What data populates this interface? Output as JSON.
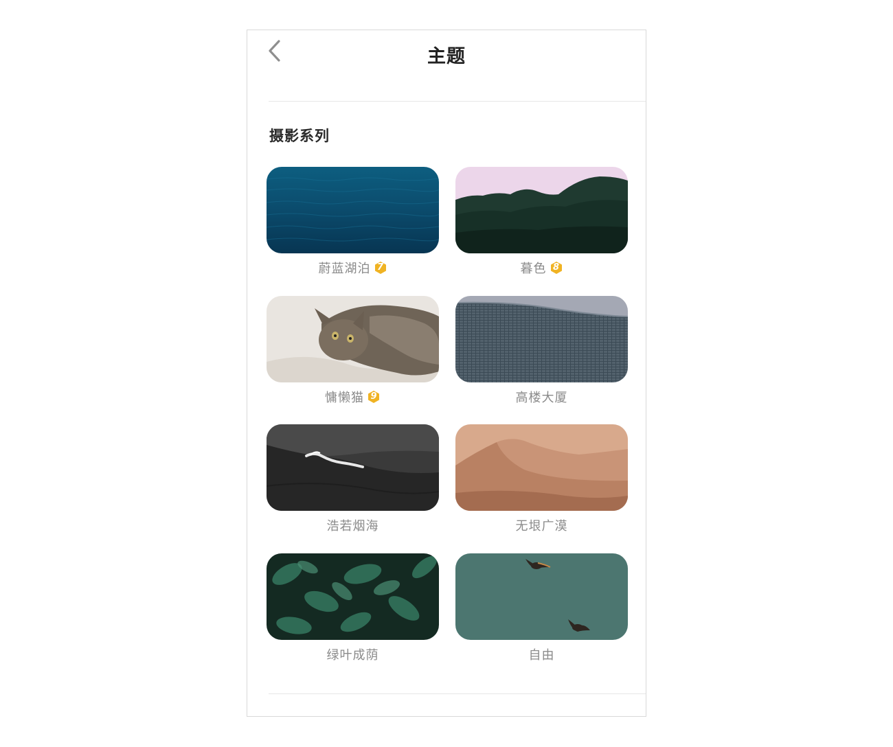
{
  "header": {
    "title": "主题",
    "back_icon": "chevron-left-icon"
  },
  "section": {
    "title": "摄影系列"
  },
  "themes": [
    {
      "name": "蔚蓝湖泊",
      "level": "7",
      "scene": "ocean"
    },
    {
      "name": "暮色",
      "level": "8",
      "scene": "mountains"
    },
    {
      "name": "慵懒猫",
      "level": "9",
      "scene": "cat"
    },
    {
      "name": "高楼大厦",
      "level": "",
      "scene": "building"
    },
    {
      "name": "浩若烟海",
      "level": "",
      "scene": "wave"
    },
    {
      "name": "无垠广漠",
      "level": "",
      "scene": "desert"
    },
    {
      "name": "绿叶成荫",
      "level": "",
      "scene": "leaves"
    },
    {
      "name": "自由",
      "level": "",
      "scene": "birds"
    }
  ],
  "colors": {
    "badge": "#f0b323",
    "caption": "#8a8a8a",
    "title": "#222222"
  }
}
